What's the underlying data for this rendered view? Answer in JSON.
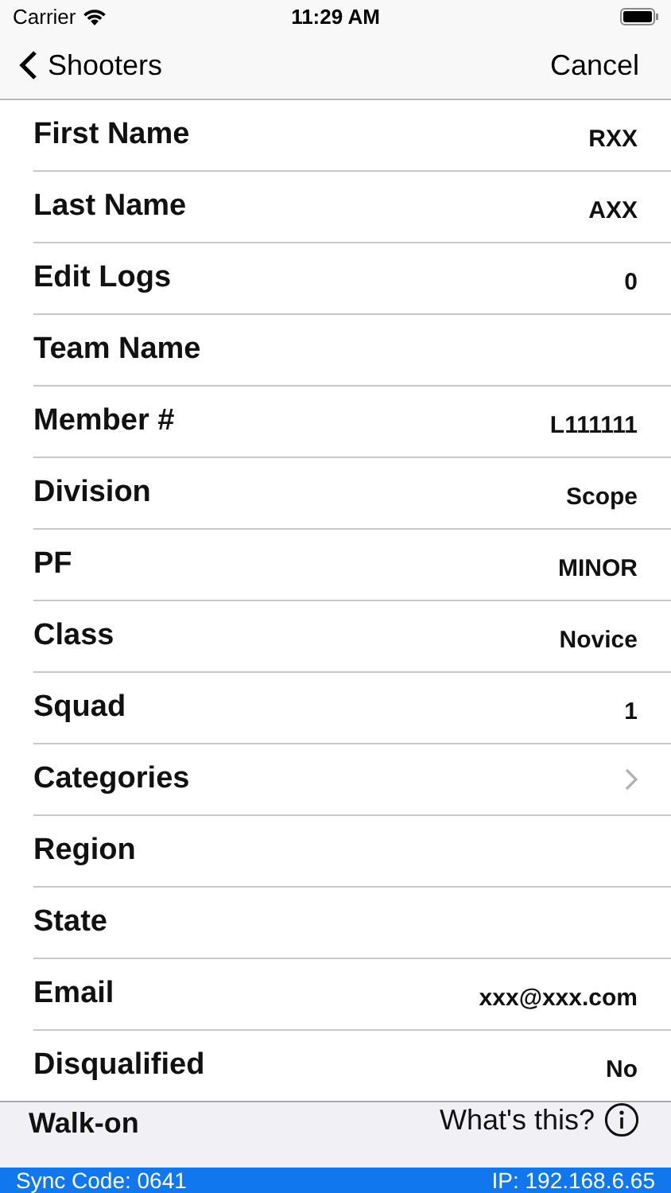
{
  "status_bar": {
    "carrier": "Carrier",
    "time": "11:29 AM"
  },
  "nav": {
    "back": "Shooters",
    "action": "Cancel"
  },
  "rows": [
    {
      "kind": "value",
      "label": "First Name",
      "value": "RXX"
    },
    {
      "kind": "value",
      "label": "Last Name",
      "value": "AXX"
    },
    {
      "kind": "value",
      "label": "Edit Logs",
      "value": "0"
    },
    {
      "kind": "value",
      "label": "Team Name"
    },
    {
      "kind": "value",
      "label": "Member #",
      "value": "L111111"
    },
    {
      "kind": "value",
      "label": "Division",
      "value": "Scope"
    },
    {
      "kind": "value",
      "label": "PF",
      "value": "MINOR"
    },
    {
      "kind": "value",
      "label": "Class",
      "value": "Novice"
    },
    {
      "kind": "value",
      "label": "Squad",
      "value": "1"
    },
    {
      "kind": "link",
      "label": "Categories"
    },
    {
      "kind": "value",
      "label": "Region"
    },
    {
      "kind": "value",
      "label": "State"
    },
    {
      "kind": "value",
      "label": "Email",
      "value": "xxx@xxx.com"
    },
    {
      "kind": "value",
      "label": "Disqualified",
      "value": "No"
    }
  ],
  "walk_on": {
    "label": "Walk-on",
    "help": "What's this?"
  },
  "footer": {
    "sync_code": "Sync Code: 0641",
    "ip": "IP: 192.168.6.65"
  }
}
